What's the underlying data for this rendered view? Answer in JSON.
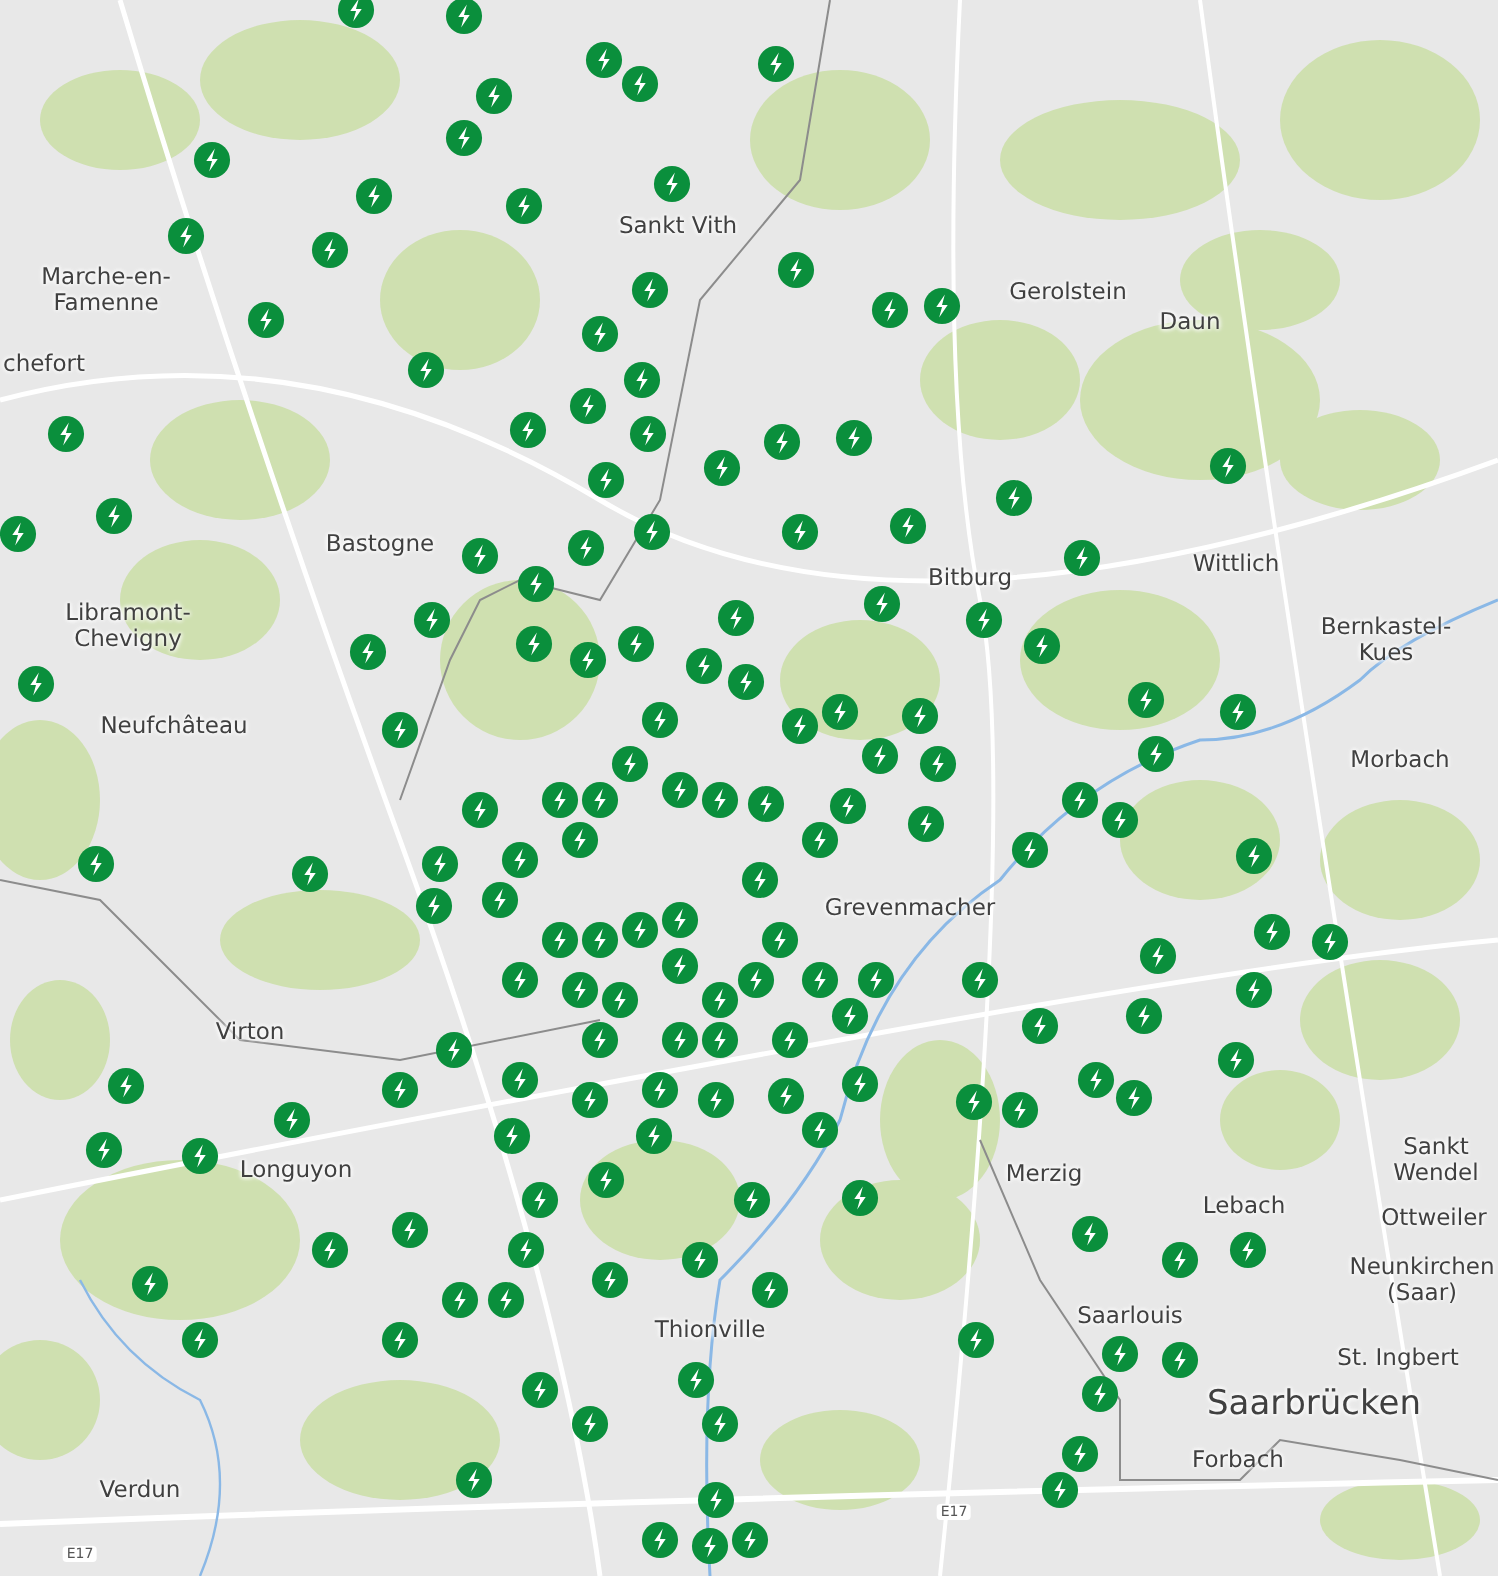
{
  "map": {
    "labels": [
      {
        "text": "Marche-en-\nFamenne",
        "kind": "town"
      },
      {
        "text": "chefort",
        "kind": "town"
      },
      {
        "text": "Sankt Vith",
        "kind": "town"
      },
      {
        "text": "Gerolstein",
        "kind": "town"
      },
      {
        "text": "Daun",
        "kind": "town"
      },
      {
        "text": "Bastogne",
        "kind": "town"
      },
      {
        "text": "Libramont-\nChevigny",
        "kind": "town"
      },
      {
        "text": "Neufchâteau",
        "kind": "town"
      },
      {
        "text": "Bitburg",
        "kind": "town"
      },
      {
        "text": "Wittlich",
        "kind": "town"
      },
      {
        "text": "Bernkastel-\nKues",
        "kind": "town"
      },
      {
        "text": "Morbach",
        "kind": "town"
      },
      {
        "text": "Grevenmacher",
        "kind": "town"
      },
      {
        "text": "Virton",
        "kind": "town"
      },
      {
        "text": "Longuyon",
        "kind": "town"
      },
      {
        "text": "Verdun",
        "kind": "town"
      },
      {
        "text": "Merzig",
        "kind": "town"
      },
      {
        "text": "Lebach",
        "kind": "town"
      },
      {
        "text": "Sankt\nWendel",
        "kind": "town"
      },
      {
        "text": "Ottweiler",
        "kind": "town"
      },
      {
        "text": "Neunkirchen\n(Saar)",
        "kind": "town"
      },
      {
        "text": "Saarlouis",
        "kind": "town"
      },
      {
        "text": "St. Ingbert",
        "kind": "town"
      },
      {
        "text": "Saarbrücken",
        "kind": "city"
      },
      {
        "text": "Forbach",
        "kind": "town"
      },
      {
        "text": "Thionville",
        "kind": "town"
      },
      {
        "text": "E17",
        "kind": "road"
      },
      {
        "text": "E17",
        "kind": "road"
      }
    ]
  }
}
